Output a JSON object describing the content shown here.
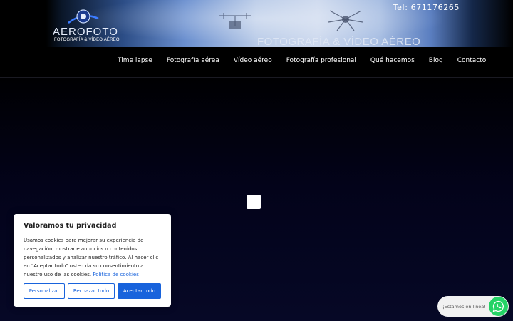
{
  "header": {
    "logo_word": "AEROFOTO",
    "logo_tagline": "FOTOGRAFÍA & VÍDEO AÉREO",
    "banner_title": "FOTOGRAFÍA  & VÍDEO AÉREO",
    "phone": "Tel: 671176265"
  },
  "nav": {
    "items": [
      {
        "label": "Time lapse"
      },
      {
        "label": "Fotografía aérea"
      },
      {
        "label": "Vídeo aéreo"
      },
      {
        "label": "Fotografía profesional"
      },
      {
        "label": "Qué hacemos"
      },
      {
        "label": "Blog"
      },
      {
        "label": "Contacto"
      }
    ]
  },
  "cookie": {
    "title": "Valoramos tu privacidad",
    "body": "Usamos cookies para mejorar su experiencia de navegación, mostrarle anuncios o contenidos personalizados y analizar nuestro tráfico. Al hacer clic en \"Aceptar todo\" usted da su consentimiento a nuestro uso de las cookies.",
    "policy_link": "Política de cookies",
    "buttons": {
      "customize": "Personalizar",
      "reject": "Rechazar todo",
      "accept": "Aceptar todo"
    },
    "accent_color": "#1863dc"
  },
  "whatsapp": {
    "status": "¡Estamos en línea!",
    "color": "#25d366",
    "icon": "whatsapp-icon"
  }
}
